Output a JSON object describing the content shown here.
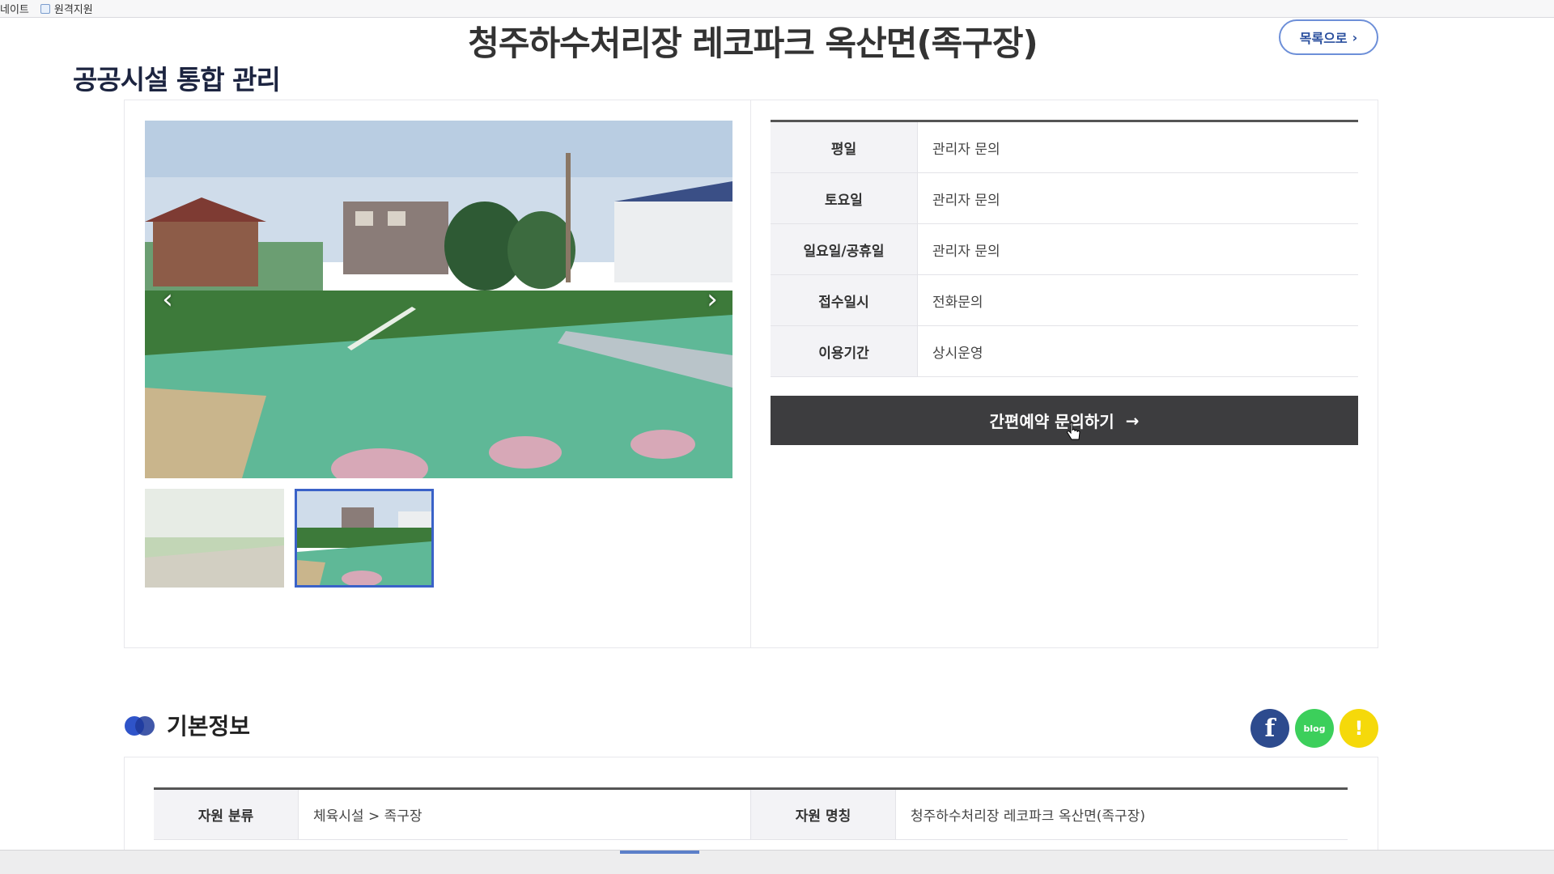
{
  "bookmarks": [
    "네이트",
    "원격지원"
  ],
  "header": {
    "title": "청주하수처리장 레코파크 옥산면(족구장)",
    "list_button": "목록으로",
    "caption": "공공시설 통합 관리"
  },
  "gallery": {
    "prev_glyph": "‹",
    "next_glyph": "›",
    "thumbnail_count": 2,
    "selected_thumbnail": 2
  },
  "info": {
    "rows": [
      {
        "label": "평일",
        "value": "관리자 문의"
      },
      {
        "label": "토요일",
        "value": "관리자 문의"
      },
      {
        "label": "일요일/공휴일",
        "value": "관리자 문의"
      },
      {
        "label": "접수일시",
        "value": "전화문의"
      },
      {
        "label": "이용기간",
        "value": "상시운영"
      }
    ],
    "reserve_button": "간편예약 문의하기",
    "reserve_arrow": "→"
  },
  "basic_info": {
    "title": "기본정보",
    "share": {
      "facebook": "f",
      "blog": "blog",
      "kakao": "!"
    },
    "rows": [
      {
        "label1": "자원 분류",
        "value1": "체육시설 > 족구장",
        "label2": "자원 명칭",
        "value2": "청주하수처리장 레코파크 옥산면(족구장)"
      }
    ]
  },
  "colors": {
    "accent": "#3a62c8",
    "button_dark": "#3d3d3f",
    "facebook": "#2d4b8e",
    "blog": "#3ccf5b",
    "kakao": "#f5d90a"
  }
}
